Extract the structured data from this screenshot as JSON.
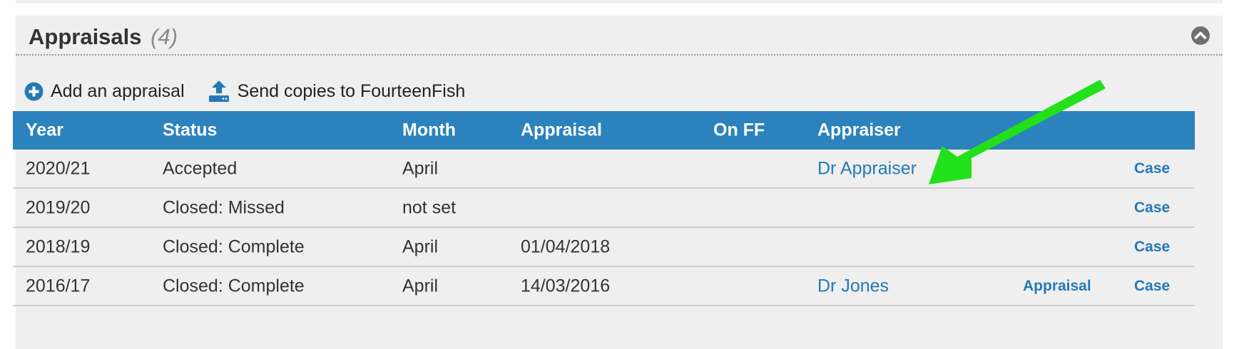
{
  "panel": {
    "title": "Appraisals",
    "count": "(4)"
  },
  "actions": {
    "add_label": "Add an appraisal",
    "send_label": "Send copies to FourteenFish"
  },
  "table": {
    "headers": {
      "year": "Year",
      "status": "Status",
      "month": "Month",
      "appraisal": "Appraisal",
      "on_ff": "On FF",
      "appraiser": "Appraiser"
    },
    "rows": [
      {
        "year": "2020/21",
        "status": "Accepted",
        "month": "April",
        "appraisal": "",
        "appraiser": "Dr Appraiser",
        "appraisal_link": "",
        "case": "Case"
      },
      {
        "year": "2019/20",
        "status": "Closed: Missed",
        "month": "not set",
        "appraisal": "",
        "appraiser": "",
        "appraisal_link": "",
        "case": "Case"
      },
      {
        "year": "2018/19",
        "status": "Closed: Complete",
        "month": "April",
        "appraisal": "01/04/2018",
        "appraiser": "",
        "appraisal_link": "",
        "case": "Case"
      },
      {
        "year": "2016/17",
        "status": "Closed: Complete",
        "month": "April",
        "appraisal": "14/03/2016",
        "appraiser": "Dr Jones",
        "appraisal_link": "Appraisal",
        "case": "Case"
      }
    ]
  },
  "colors": {
    "header_bg": "#2b82bd",
    "link": "#2479b5",
    "panel_bg": "#efefef",
    "annotation_arrow": "#22e01a"
  }
}
